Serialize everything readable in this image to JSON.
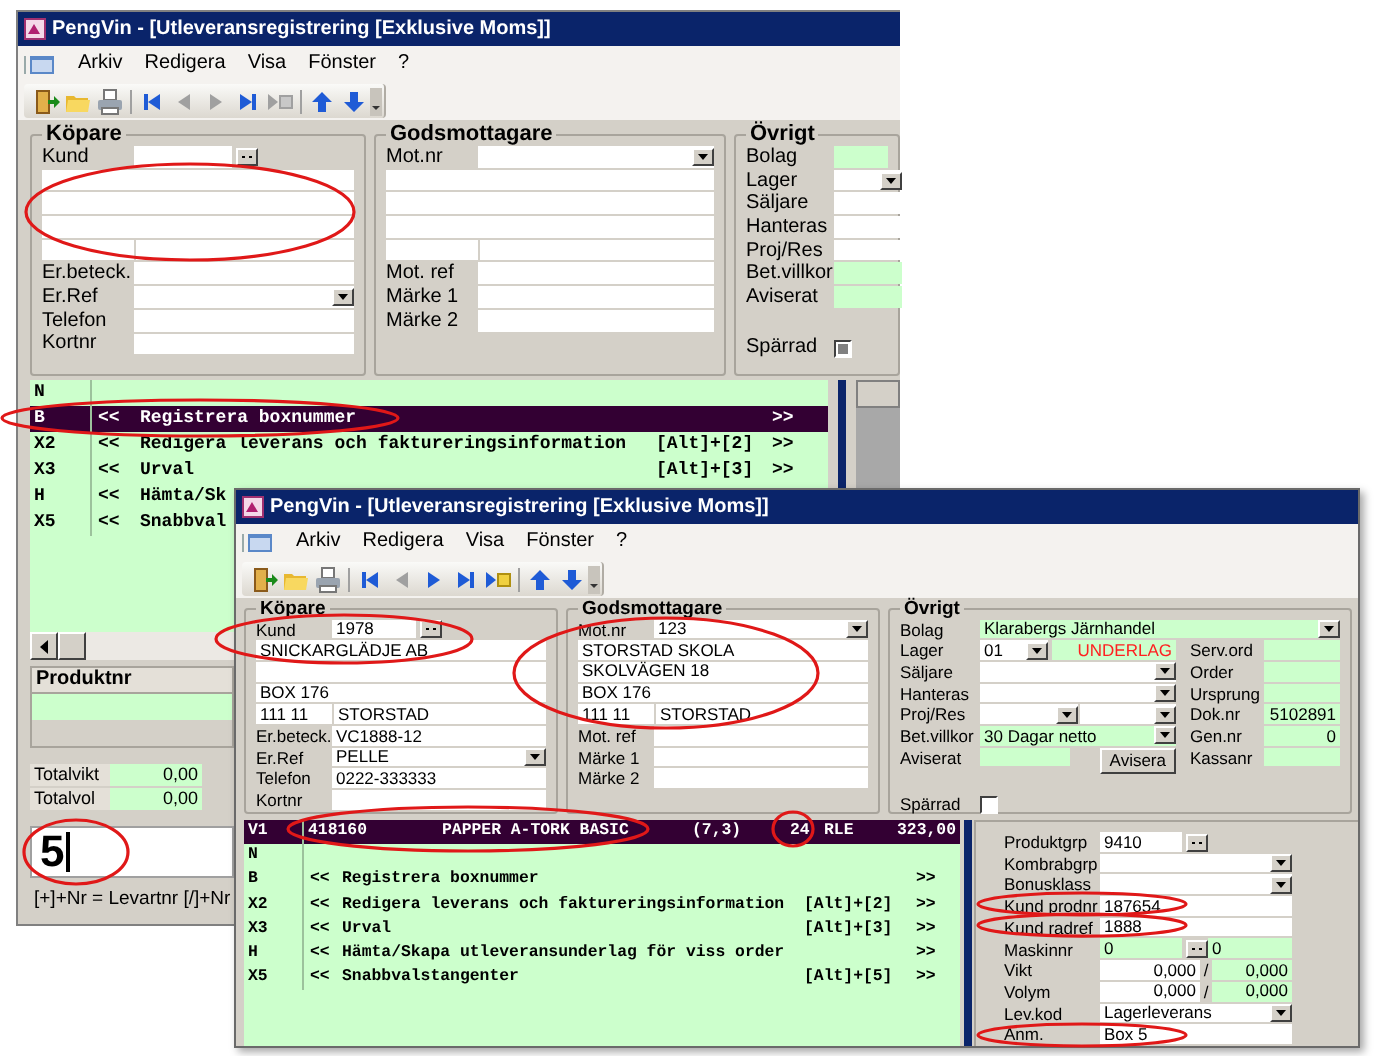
{
  "back_window": {
    "title": "PengVin - [Utleveransregistrering [Exklusive Moms]]",
    "menu": [
      {
        "label": "Arkiv"
      },
      {
        "label": "Redigera"
      },
      {
        "label": "Visa"
      },
      {
        "label": "Fönster"
      },
      {
        "label": "?"
      }
    ],
    "toolbar": [
      {
        "kind": "exit",
        "disabled": false
      },
      {
        "kind": "open",
        "disabled": false
      },
      {
        "kind": "print",
        "disabled": false
      },
      {
        "kind": "separator"
      },
      {
        "kind": "first",
        "disabled": false
      },
      {
        "kind": "prev",
        "disabled": true
      },
      {
        "kind": "next",
        "disabled": true
      },
      {
        "kind": "last",
        "disabled": false
      },
      {
        "kind": "new",
        "disabled": true
      },
      {
        "kind": "separator"
      },
      {
        "kind": "up",
        "disabled": false
      },
      {
        "kind": "down",
        "disabled": false
      }
    ],
    "buyer": {
      "heading": "Köpare",
      "first": {
        "label": "Kund",
        "kind": "lookup"
      },
      "fields": [
        {
          "label": "Er.beteck.",
          "kind": "text"
        },
        {
          "label": "Er.Ref",
          "kind": "dropdown"
        },
        {
          "label": "Telefon",
          "kind": "text"
        },
        {
          "label": "Kortnr",
          "kind": "text"
        }
      ]
    },
    "consignee": {
      "heading": "Godsmottagare",
      "first": {
        "label": "Mot.nr",
        "kind": "dropdown"
      },
      "fields": [
        {
          "label": "Mot. ref",
          "kind": "text"
        },
        {
          "label": "Märke 1",
          "kind": "text"
        },
        {
          "label": "Märke 2",
          "kind": "text"
        }
      ]
    },
    "other": {
      "heading": "Övrigt",
      "top": {
        "label": "Bolag",
        "kind": "text",
        "readonly": true
      },
      "left": [
        {
          "label": "Lager",
          "kind": "lager"
        },
        {
          "label": "Säljare",
          "kind": "text",
          "readonly": false
        },
        {
          "label": "Hanteras",
          "kind": "text",
          "readonly": false
        },
        {
          "label": "Proj/Res",
          "kind": "text",
          "readonly": false
        },
        {
          "label": "Bet.villkor",
          "kind": "text",
          "readonly": true
        },
        {
          "label": "Aviserat",
          "kind": "text",
          "readonly": true
        }
      ],
      "blocked": {
        "label": "Spärrad",
        "checked": true
      }
    },
    "commands": [
      {
        "kind": "command",
        "code": "N",
        "selected": false
      },
      {
        "kind": "command",
        "code": "B",
        "prefix": "<<",
        "text": "Registrera boxnummer",
        "suffix": ">>",
        "selected": true
      },
      {
        "kind": "command",
        "code": "X2",
        "prefix": "<<",
        "text": "Redigera leverans och faktureringsinformation",
        "keys": "[Alt]+[2]",
        "suffix": ">>",
        "selected": false
      },
      {
        "kind": "command",
        "code": "X3",
        "prefix": "<<",
        "text": "Urval",
        "keys": "[Alt]+[3]",
        "suffix": ">>",
        "selected": false
      },
      {
        "kind": "command",
        "code": "H",
        "prefix": "<<",
        "text": "Hämta/Sk",
        "selected": false
      },
      {
        "kind": "command",
        "code": "X5",
        "prefix": "<<",
        "text": "Snabbval",
        "selected": false
      }
    ],
    "product_header": "Produktnr",
    "totals": [
      {
        "label": "Totalvikt",
        "value": "0,00"
      },
      {
        "label": "Totalvol",
        "value": "0,00"
      }
    ],
    "entry": {
      "value": "5"
    },
    "status": "[+]+Nr = Levartnr [/]+Nr"
  },
  "front_window": {
    "title": "PengVin - [Utleveransregistrering [Exklusive Moms]]",
    "menu": [
      {
        "label": "Arkiv"
      },
      {
        "label": "Redigera"
      },
      {
        "label": "Visa"
      },
      {
        "label": "Fönster"
      },
      {
        "label": "?"
      }
    ],
    "toolbar": [
      {
        "kind": "exit",
        "disabled": false
      },
      {
        "kind": "open",
        "disabled": false
      },
      {
        "kind": "print",
        "disabled": false
      },
      {
        "kind": "separator"
      },
      {
        "kind": "first",
        "disabled": false
      },
      {
        "kind": "prev",
        "disabled": true
      },
      {
        "kind": "next",
        "disabled": false
      },
      {
        "kind": "last",
        "disabled": false
      },
      {
        "kind": "new",
        "disabled": false
      },
      {
        "kind": "separator"
      },
      {
        "kind": "up",
        "disabled": false
      },
      {
        "kind": "down",
        "disabled": false
      }
    ],
    "buyer": {
      "heading": "Köpare",
      "first": {
        "label": "Kund",
        "kind": "lookup",
        "value": "1978"
      },
      "address": {
        "line_1": "SNICKARGLÄDJE AB",
        "line_3": "BOX 176"
      },
      "postal": {
        "zip": "111 11",
        "city": "STORSTAD"
      },
      "fields": [
        {
          "label": "Er.beteck.",
          "kind": "text",
          "value": "VC1888-12"
        },
        {
          "label": "Er.Ref",
          "kind": "dropdown",
          "value": "PELLE"
        },
        {
          "label": "Telefon",
          "kind": "text",
          "value": "0222-333333"
        },
        {
          "label": "Kortnr",
          "kind": "text"
        }
      ]
    },
    "consignee": {
      "heading": "Godsmottagare",
      "first": {
        "label": "Mot.nr",
        "kind": "dropdown",
        "value": "123"
      },
      "address": {
        "line_1": "STORSTAD SKOLA",
        "line_2": "SKOLVÄGEN 18",
        "line_3": "BOX 176"
      },
      "postal": {
        "zip": "111 11",
        "city": "STORSTAD"
      },
      "fields": [
        {
          "label": "Mot. ref",
          "kind": "text"
        },
        {
          "label": "Märke 1",
          "kind": "text"
        },
        {
          "label": "Märke 2",
          "kind": "text"
        }
      ]
    },
    "other": {
      "heading": "Övrigt",
      "top": {
        "label": "Bolag",
        "kind": "dropdown",
        "readonly": true,
        "value": "Klarabergs  Järnhandel"
      },
      "left": [
        {
          "label": "Lager",
          "kind": "lager",
          "value": "01",
          "status": "UNDERLAG"
        },
        {
          "label": "Säljare",
          "kind": "dropdown",
          "readonly": false
        },
        {
          "label": "Hanteras",
          "kind": "dropdown",
          "readonly": false
        },
        {
          "label": "Proj/Res",
          "kind": "split"
        },
        {
          "label": "Bet.villkor",
          "kind": "dropdown",
          "readonly": true,
          "value": "30 Dagar netto"
        },
        {
          "label": "Aviserat",
          "kind": "text",
          "readonly": true,
          "button": "Avisera"
        }
      ],
      "right": [
        {
          "label": "Serv.ord",
          "kind": "text",
          "readonly": true
        },
        {
          "label": "Order",
          "kind": "text",
          "readonly": true
        },
        {
          "label": "Ursprung",
          "kind": "text",
          "readonly": true
        },
        {
          "label": "Dok.nr",
          "kind": "number",
          "readonly": true,
          "value": "5102891"
        },
        {
          "label": "Gen.nr",
          "kind": "number",
          "readonly": true,
          "value": "0"
        },
        {
          "label": "Kassanr",
          "kind": "text",
          "readonly": true
        }
      ],
      "blocked": {
        "label": "Spärrad",
        "checked": false
      }
    },
    "commands": [
      {
        "kind": "item",
        "code": "V1",
        "cells": [
          "418160",
          "PAPPER A-TORK BASIC",
          "(7,3)",
          "24",
          "RLE",
          "323,00"
        ],
        "selected": true
      },
      {
        "kind": "command",
        "code": "N",
        "selected": false
      },
      {
        "kind": "command",
        "code": "B",
        "prefix": "<<",
        "text": "Registrera boxnummer",
        "suffix": ">>",
        "selected": false
      },
      {
        "kind": "command",
        "code": "X2",
        "prefix": "<<",
        "text": "Redigera leverans och faktureringsinformation",
        "keys": "[Alt]+[2]",
        "suffix": ">>",
        "selected": false
      },
      {
        "kind": "command",
        "code": "X3",
        "prefix": "<<",
        "text": "Urval",
        "keys": "[Alt]+[3]",
        "suffix": ">>",
        "selected": false
      },
      {
        "kind": "command",
        "code": "H",
        "prefix": "<<",
        "text": "Hämta/Skapa utleveransunderlag för viss order",
        "suffix": ">>",
        "selected": false
      },
      {
        "kind": "command",
        "code": "X5",
        "prefix": "<<",
        "text": "Snabbvalstangenter",
        "keys": "[Alt]+[5]",
        "suffix": ">>",
        "selected": false
      }
    ],
    "product_fields": [
      {
        "label": "Produktgrp",
        "kind": "lookup",
        "value": "9410"
      },
      {
        "label": "Kombrabgrp",
        "kind": "dropdown"
      },
      {
        "label": "Bonusklass",
        "kind": "dropdown"
      },
      {
        "label": "Kund prodnr",
        "kind": "text",
        "value": "187654"
      },
      {
        "label": "Kund radref",
        "kind": "text",
        "value": "1888"
      },
      {
        "label": "Maskinnr",
        "kind": "lookup-pair",
        "value": "0",
        "value2": "0"
      },
      {
        "label": "Vikt",
        "kind": "pair",
        "value": "0,000",
        "separator": "/",
        "value2": "0,000"
      },
      {
        "label": "Volym",
        "kind": "pair",
        "value": "0,000",
        "separator": "/",
        "value2": "0,000"
      },
      {
        "label": "Lev.kod",
        "kind": "dropdown",
        "value": "Lagerleverans"
      },
      {
        "label": "Anm.",
        "kind": "text",
        "value": "Box 5"
      }
    ]
  }
}
